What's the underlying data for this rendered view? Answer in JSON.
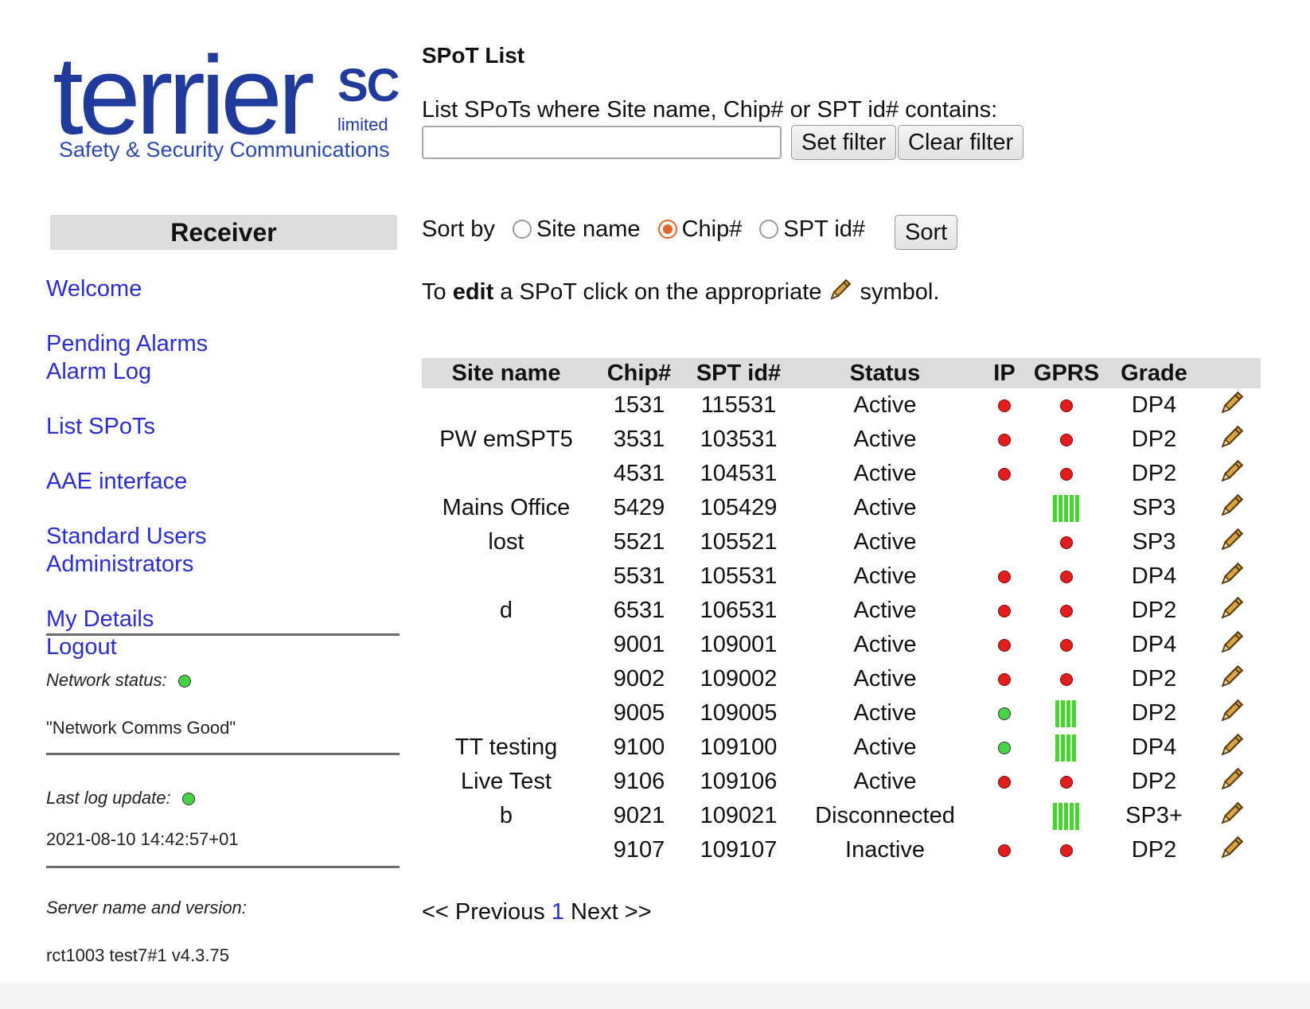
{
  "logo": {
    "word": "terrier",
    "sc": "SC",
    "limited": "limited",
    "tagline": "Safety & Security Communications"
  },
  "receiver_title": "Receiver",
  "nav": {
    "welcome": "Welcome",
    "pending_alarms": "Pending Alarms",
    "alarm_log": "Alarm Log",
    "list_spots": "List SPoTs",
    "aae_interface": "AAE interface",
    "standard_users": "Standard Users",
    "administrators": "Administrators",
    "my_details": "My Details",
    "logout": "Logout"
  },
  "status": {
    "network_label": "Network status:",
    "network_value": "\"Network Comms Good\"",
    "log_label": "Last log update:",
    "log_value": "2021-08-10 14:42:57+01",
    "server_label": "Server name and version:",
    "server_value": "rct1003 test7#1 v4.3.75"
  },
  "page": {
    "title": "SPoT List",
    "filter_label": "List SPoTs where Site name, Chip# or SPT id# contains:",
    "filter_value": "",
    "set_filter": "Set filter",
    "clear_filter": "Clear filter",
    "sort_by": "Sort by",
    "sort_options": [
      "Site name",
      "Chip#",
      "SPT id#"
    ],
    "sort_selected": "Chip#",
    "sort_button": "Sort",
    "edit_prefix": "To ",
    "edit_bold": "edit",
    "edit_mid": " a SPoT click on the appropriate ",
    "edit_suffix": " symbol."
  },
  "table": {
    "headers": [
      "Site name",
      "Chip#",
      "SPT id#",
      "Status",
      "IP",
      "GPRS",
      "Grade"
    ],
    "rows": [
      {
        "site": "",
        "chip": "1531",
        "spt": "115531",
        "status": "Active",
        "ip": "red",
        "gprs": "red",
        "grade": "DP4"
      },
      {
        "site": "PW emSPT5",
        "chip": "3531",
        "spt": "103531",
        "status": "Active",
        "ip": "red",
        "gprs": "red",
        "grade": "DP2"
      },
      {
        "site": "",
        "chip": "4531",
        "spt": "104531",
        "status": "Active",
        "ip": "red",
        "gprs": "red",
        "grade": "DP2"
      },
      {
        "site": "Mains Office",
        "chip": "5429",
        "spt": "105429",
        "status": "Active",
        "ip": "",
        "gprs": "bars5",
        "grade": "SP3"
      },
      {
        "site": "lost",
        "chip": "5521",
        "spt": "105521",
        "status": "Active",
        "ip": "",
        "gprs": "red",
        "grade": "SP3"
      },
      {
        "site": "",
        "chip": "5531",
        "spt": "105531",
        "status": "Active",
        "ip": "red",
        "gprs": "red",
        "grade": "DP4"
      },
      {
        "site": "d",
        "chip": "6531",
        "spt": "106531",
        "status": "Active",
        "ip": "red",
        "gprs": "red",
        "grade": "DP2"
      },
      {
        "site": "",
        "chip": "9001",
        "spt": "109001",
        "status": "Active",
        "ip": "red",
        "gprs": "red",
        "grade": "DP4"
      },
      {
        "site": "",
        "chip": "9002",
        "spt": "109002",
        "status": "Active",
        "ip": "red",
        "gprs": "red",
        "grade": "DP2"
      },
      {
        "site": "",
        "chip": "9005",
        "spt": "109005",
        "status": "Active",
        "ip": "green",
        "gprs": "bars4",
        "grade": "DP2"
      },
      {
        "site": "TT testing",
        "chip": "9100",
        "spt": "109100",
        "status": "Active",
        "ip": "green",
        "gprs": "bars4",
        "grade": "DP4"
      },
      {
        "site": "Live Test",
        "chip": "9106",
        "spt": "109106",
        "status": "Active",
        "ip": "red",
        "gprs": "red",
        "grade": "DP2"
      },
      {
        "site": "b",
        "chip": "9021",
        "spt": "109021",
        "status": "Disconnected",
        "ip": "",
        "gprs": "bars5",
        "grade": "SP3+"
      },
      {
        "site": "",
        "chip": "9107",
        "spt": "109107",
        "status": "Inactive",
        "ip": "red",
        "gprs": "red",
        "grade": "DP2"
      }
    ]
  },
  "pager": {
    "prev": "<< Previous",
    "page": "1",
    "next": "Next >>"
  },
  "colors": {
    "link": "#2a2ed0",
    "brand": "#1f3a9a",
    "dot_red": "#e11d1d",
    "dot_green": "#47d247",
    "gprs_bar": "#44d62c",
    "radio_accent": "#e2622a"
  }
}
